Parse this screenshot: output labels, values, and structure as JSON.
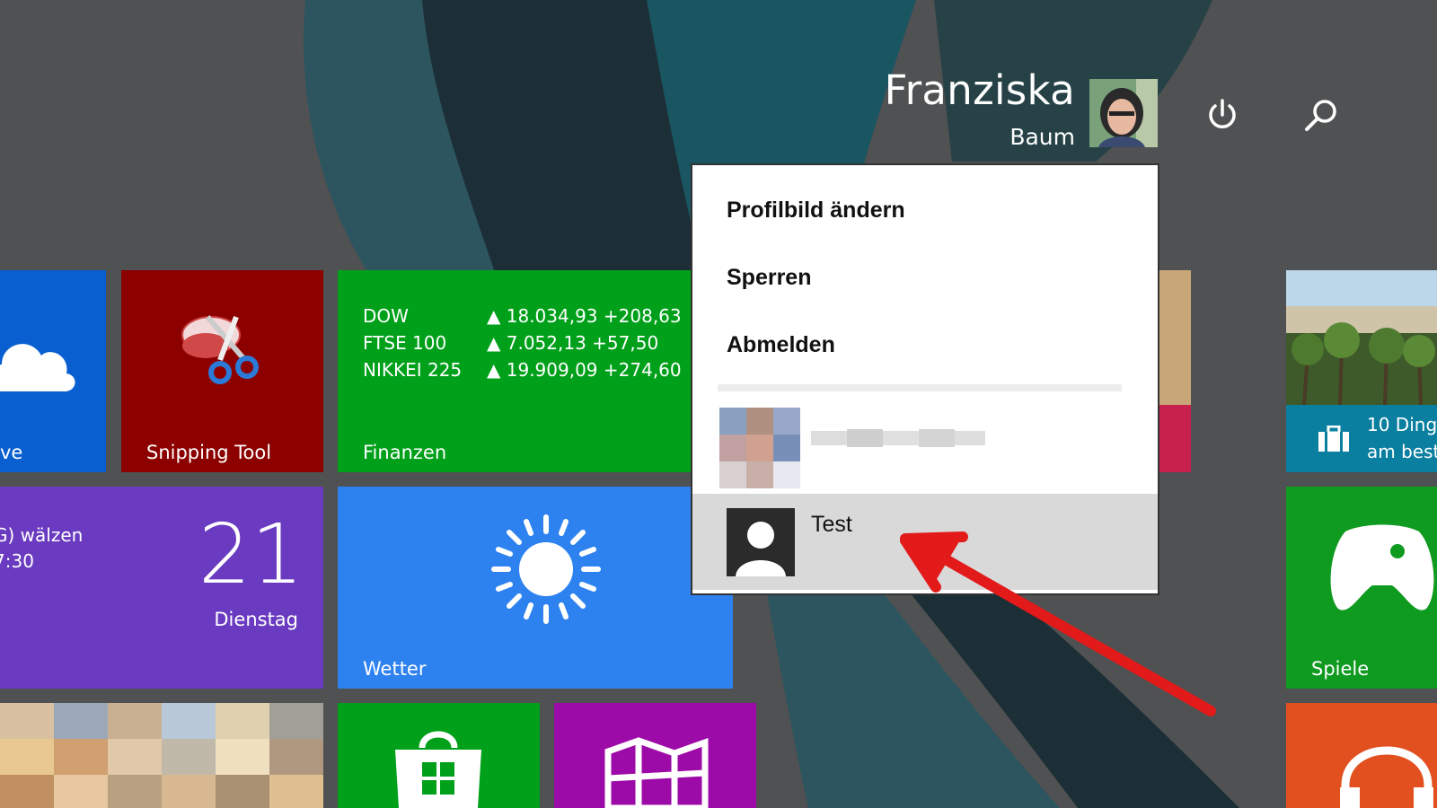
{
  "user": {
    "first_name": "Franziska",
    "last_name": "Baum"
  },
  "header": {
    "power_icon": "power-icon",
    "search_icon": "search-icon"
  },
  "account_menu": {
    "items": [
      "Profilbild ändern",
      "Sperren",
      "Abmelden"
    ],
    "other_account_1": "",
    "other_account_2": "Test"
  },
  "tiles": {
    "onedrive_partial": "ve",
    "snipping_tool": "Snipping Tool",
    "finance": {
      "label": "Finanzen",
      "rows": [
        {
          "name": "DOW",
          "value": "▲ 18.034,93 +208,63"
        },
        {
          "name": "FTSE 100",
          "value": "▲ 7.052,13 +57,50"
        },
        {
          "name": "NIKKEI 225",
          "value": "▲ 19.909,09 +274,60"
        }
      ]
    },
    "calendar": {
      "line1": "G) wälzen",
      "line2": "7:30",
      "day": "21",
      "weekday": "Dienstag"
    },
    "weather": "Wetter",
    "travel": {
      "line1": "10 Ding",
      "line2": "am best"
    },
    "games": "Spiele"
  },
  "colors": {
    "onedrive": "#0a5fd0",
    "snipping": "#8c0000",
    "finance": "#00a01a",
    "calendar": "#6a3bc0",
    "weather": "#2e82f0",
    "store": "#00a01a",
    "purple_app": "#9c0aa8",
    "games": "#0f9a20",
    "music": "#e25020",
    "pink": "#c9214e",
    "arrow": "#e21a1a"
  }
}
